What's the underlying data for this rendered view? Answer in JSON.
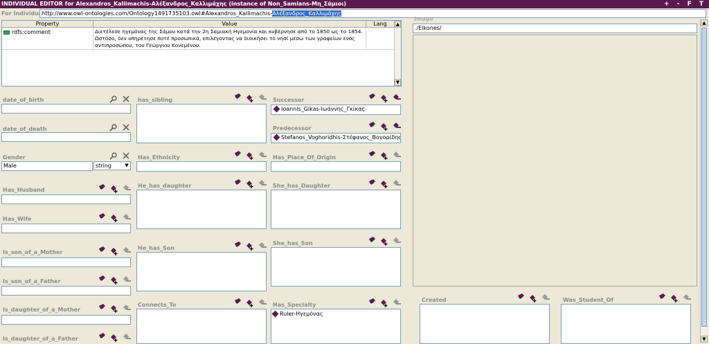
{
  "window": {
    "title": "INDIVIDUAL EDITOR for Alexandros_Kallimachis-Αλέξανδρος_Καλλιμάχης  (instance of Non_Samians-Μη_Σάμιοι)",
    "controls": "+ - F T"
  },
  "individual": {
    "label": "For Individual:",
    "url_prefix": "http://www.owl-ontologies.com/Ontology1491735103.owl#Alexandros_Kallimachis-",
    "url_selected": "Αλέξανδρος_Καλλιμάχης"
  },
  "annotations": {
    "headers": [
      "Property",
      "Value",
      "Lang"
    ],
    "rows": [
      {
        "property": "rdfs:comment",
        "value": "Διετέλεσε ηγεμόνας της Σάμου κατά την 2η Σαμιακή Ηγεμονία και κυβέρνησε από το 1850 ως το 1854. Ωστόσο, δεν υπηρέτησε ποτέ προσωπικά, επιλέγοντας να διοικήσει το νησί μέσω των γραφείων ενός αντιπροσώπου, του Γεώργιου Κονεμένου.",
        "lang": ""
      }
    ]
  },
  "image": {
    "label": "Image",
    "value": "./Eikones/"
  },
  "fields": {
    "date_of_birth": {
      "label": "date_of_birth",
      "value": ""
    },
    "date_of_death": {
      "label": "date_of_death",
      "value": ""
    },
    "gender": {
      "label": "Gender",
      "value": "Male",
      "type": "string"
    },
    "has_husband": {
      "label": "Has_Husband",
      "value": ""
    },
    "has_wife": {
      "label": "Has_Wife",
      "value": ""
    },
    "is_son_of_a_mother": {
      "label": "Is_son_of_a_Mother",
      "value": ""
    },
    "is_son_of_a_father": {
      "label": "Is_son_of_a_Father",
      "value": ""
    },
    "is_daughter_of_a_mother": {
      "label": "Is_daughter_of_a_Mother",
      "value": ""
    },
    "is_daughter_of_a_father": {
      "label": "Is_daughter_of_a_Father",
      "value": ""
    },
    "has_sibling": {
      "label": "has_sibling"
    },
    "has_ethnicity": {
      "label": "Has_Ethnicity",
      "value": ""
    },
    "he_has_daughter": {
      "label": "He_has_daughter"
    },
    "he_has_son": {
      "label": "He_has_Son"
    },
    "connects_to": {
      "label": "Connects_To"
    },
    "successor": {
      "label": "Successor",
      "value": "Ioannis_Gikas-Ιωάννης_Γκίκας"
    },
    "predecessor": {
      "label": "Predecessor",
      "value": "Stefanos_Voghoridhis-Στέφανος_Βογορίδης"
    },
    "has_place_of_origin": {
      "label": "Has_Place_Of_Origin",
      "value": ""
    },
    "she_has_daughter": {
      "label": "She_has_Daughter"
    },
    "she_has_son": {
      "label": "She_has_Son"
    },
    "has_specialty": {
      "label": "Has_Specialty",
      "value": "Ruler-Ηγεμόνας"
    },
    "created": {
      "label": "Created"
    },
    "was_student_of": {
      "label": "Was_Student_Of"
    }
  },
  "icons": {
    "search": "search-icon",
    "delete": "delete-icon",
    "view": "view-instance-icon",
    "add": "add-instance-icon",
    "remove": "remove-instance-icon"
  },
  "colors": {
    "titlebar": "#5b1a4d",
    "instance": "#5b1a4d",
    "selection": "#3169c6",
    "background": "#ece9d8"
  }
}
